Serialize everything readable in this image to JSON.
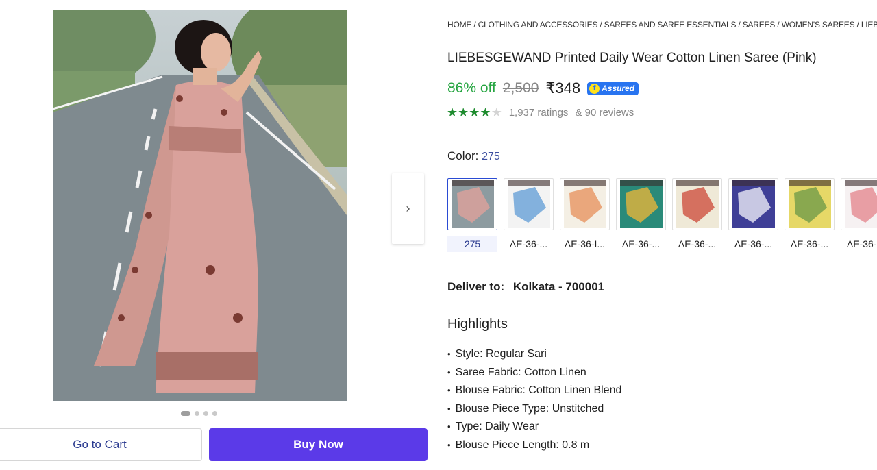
{
  "gallery": {
    "image_alt": "Woman in pink printed saree on road",
    "dots": 4,
    "active_dot": 0,
    "next_icon": "chevron-right-icon"
  },
  "actions": {
    "cart_label": "Go to Cart",
    "buy_label": "Buy Now"
  },
  "breadcrumb": [
    "Home",
    "Clothing and Accessories",
    "Sarees and Saree Essentials",
    "Sarees",
    "Women's Sarees",
    "Lieb"
  ],
  "product": {
    "title": "LIEBESGEWAND Printed Daily Wear Cotton Linen Saree (Pink)",
    "discount": "86% off",
    "mrp": "2,500",
    "price": "₹348",
    "assured_label": "Assured",
    "rating_stars": 4,
    "rating_max": 5,
    "ratings_text": "1,937 ratings",
    "reviews_text": "& 90 reviews"
  },
  "color": {
    "label": "Color:",
    "selected": "275",
    "options": [
      {
        "name": "275",
        "colors": [
          "#8d9ba0",
          "#d9a19b"
        ]
      },
      {
        "name": "AE-36-...",
        "colors": [
          "#f3f3f3",
          "#6fa4d8"
        ]
      },
      {
        "name": "AE-36-I...",
        "colors": [
          "#f4efe4",
          "#e79a6a"
        ]
      },
      {
        "name": "AE-36-...",
        "colors": [
          "#2a8a79",
          "#d9b23e"
        ]
      },
      {
        "name": "AE-36-...",
        "colors": [
          "#efe9d7",
          "#d05a4a"
        ]
      },
      {
        "name": "AE-36-...",
        "colors": [
          "#3f3f97",
          "#e0e0f0"
        ]
      },
      {
        "name": "AE-36-...",
        "colors": [
          "#e6d867",
          "#78a04b"
        ]
      },
      {
        "name": "AE-36-...",
        "colors": [
          "#f6f1f2",
          "#e58f96"
        ]
      }
    ]
  },
  "delivery": {
    "label": "Deliver to:",
    "location": "Kolkata - 700001"
  },
  "highlights": {
    "title": "Highlights",
    "items": [
      "Style: Regular Sari",
      "Saree Fabric: Cotton Linen",
      "Blouse Fabric: Cotton Linen Blend",
      "Blouse Piece Type: Unstitched",
      "Type: Daily Wear",
      "Blouse Piece Length: 0.8 m"
    ]
  }
}
